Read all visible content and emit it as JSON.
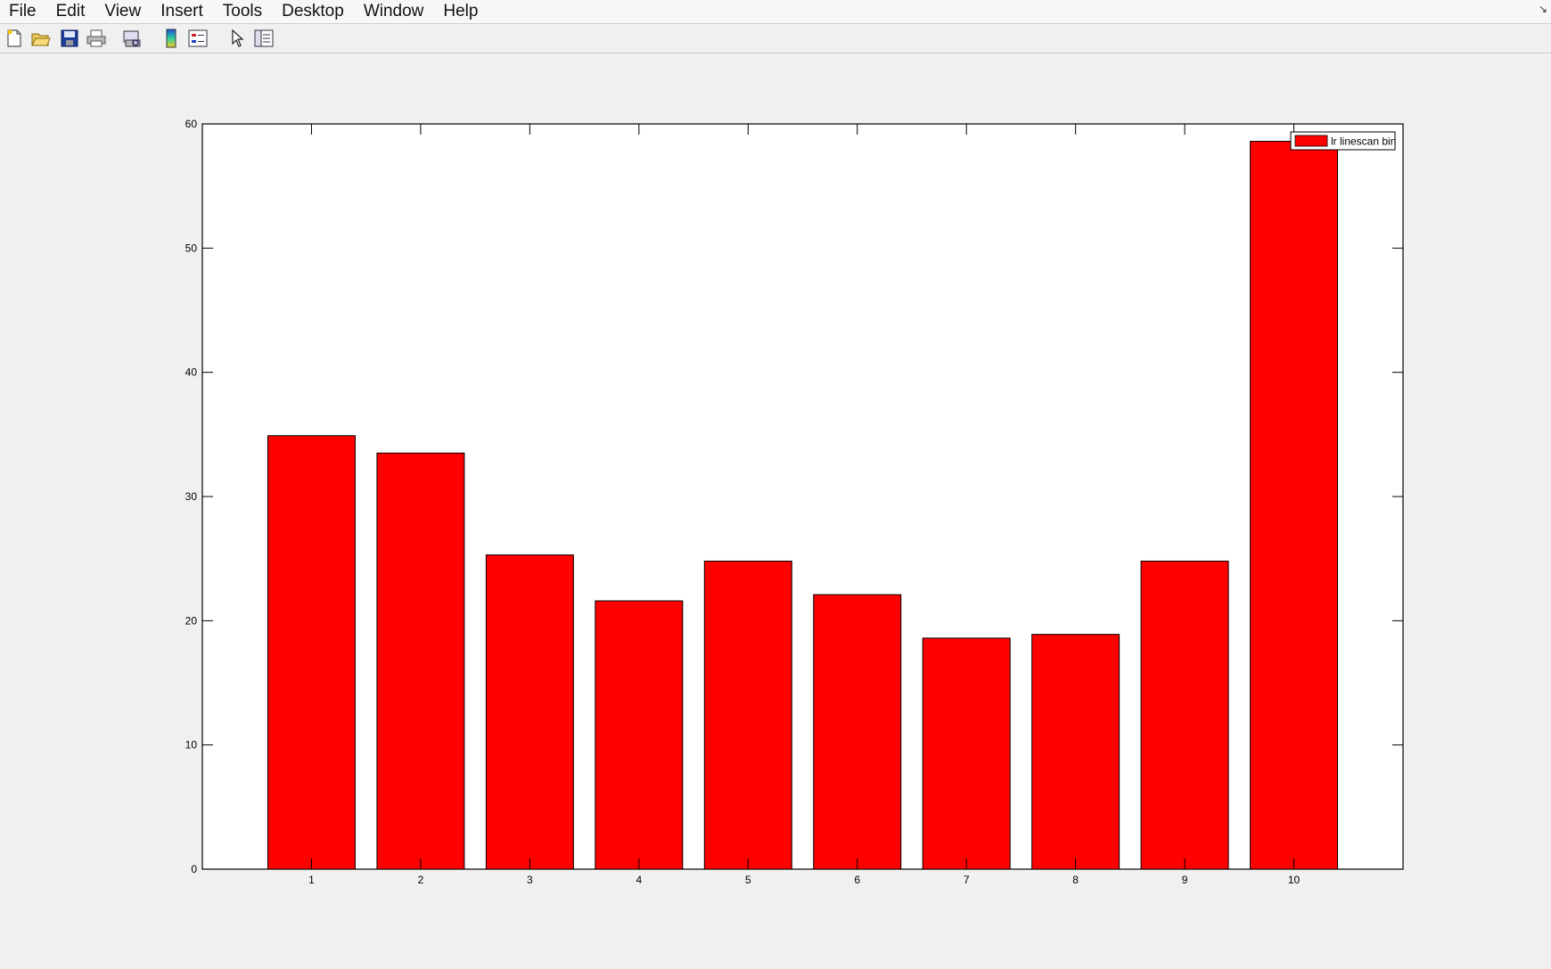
{
  "menubar": {
    "items": [
      "File",
      "Edit",
      "View",
      "Insert",
      "Tools",
      "Desktop",
      "Window",
      "Help"
    ],
    "corner_glyph": "↘"
  },
  "toolbar": {
    "icons": [
      "new-figure-icon",
      "open-file-icon",
      "save-icon",
      "print-icon",
      "print-preview-icon",
      "colorbar-icon",
      "legend-icon",
      "pointer-icon",
      "property-inspector-icon"
    ]
  },
  "chart_data": {
    "type": "bar",
    "categories": [
      "1",
      "2",
      "3",
      "4",
      "5",
      "6",
      "7",
      "8",
      "9",
      "10"
    ],
    "series": [
      {
        "name": "lr linescan bin",
        "values": [
          34.9,
          33.5,
          25.3,
          21.6,
          24.8,
          22.1,
          18.6,
          18.9,
          24.8,
          58.6
        ],
        "color": "#ff0000"
      }
    ],
    "yticks": [
      0,
      10,
      20,
      30,
      40,
      50,
      60
    ],
    "ylim": [
      0,
      60
    ],
    "xlim": [
      0,
      11
    ],
    "grid": false,
    "legend_position": "top-right"
  }
}
